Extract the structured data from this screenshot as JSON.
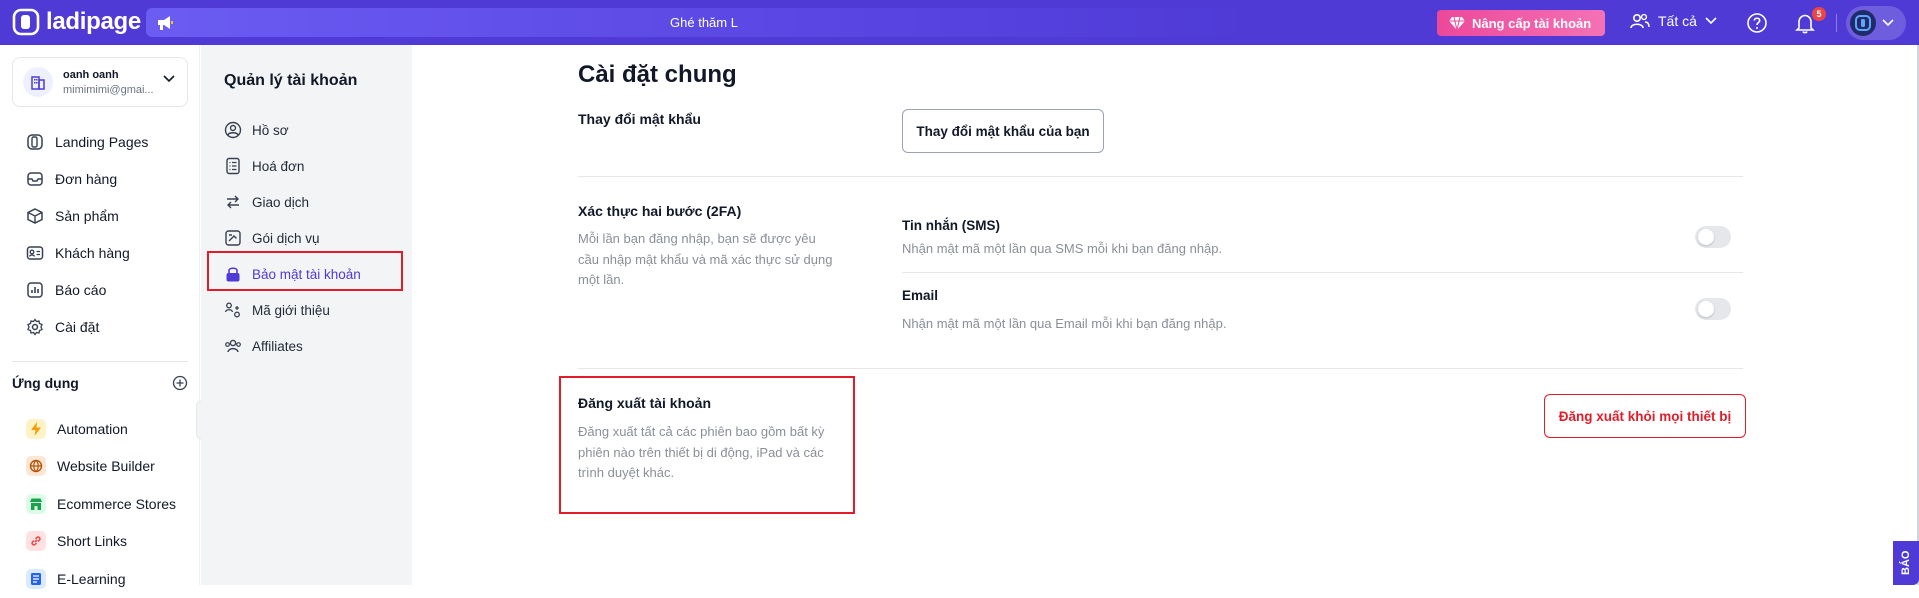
{
  "brand": {
    "name": "ladipage"
  },
  "topbar": {
    "announcement": "Ghé thăm L",
    "upgrade_label": "Nâng cấp tài khoản",
    "workspace_label": "Tất cả",
    "notification_count": "5"
  },
  "account": {
    "name": "oanh oanh",
    "email": "mimimimi@gmai..."
  },
  "nav": [
    {
      "label": "Landing Pages",
      "icon": "page-icon"
    },
    {
      "label": "Đơn hàng",
      "icon": "inbox-icon"
    },
    {
      "label": "Sản phẩm",
      "icon": "box-icon"
    },
    {
      "label": "Khách hàng",
      "icon": "contact-card-icon"
    },
    {
      "label": "Báo cáo",
      "icon": "chart-icon"
    },
    {
      "label": "Cài đặt",
      "icon": "gear-icon"
    }
  ],
  "apps": {
    "title": "Ứng dụng",
    "items": [
      {
        "label": "Automation",
        "icon": "bolt-icon",
        "color": "#f59e0b"
      },
      {
        "label": "Website Builder",
        "icon": "globe-icon",
        "color": "#b45309"
      },
      {
        "label": "Ecommerce Stores",
        "icon": "store-icon",
        "color": "#16a34a"
      },
      {
        "label": "Short Links",
        "icon": "link-icon",
        "color": "#ef4444"
      },
      {
        "label": "E-Learning",
        "icon": "book-icon",
        "color": "#2563eb"
      }
    ]
  },
  "account_menu": {
    "title": "Quản lý tài khoản",
    "items": [
      {
        "label": "Hồ sơ",
        "icon": "user-circle-icon"
      },
      {
        "label": "Hoá đơn",
        "icon": "invoice-icon"
      },
      {
        "label": "Giao dịch",
        "icon": "transfer-icon"
      },
      {
        "label": "Gói dịch vụ",
        "icon": "package-icon"
      },
      {
        "label": "Bảo mật tài khoản",
        "icon": "lock-icon"
      },
      {
        "label": "Mã giới thiệu",
        "icon": "referral-icon"
      },
      {
        "label": "Affiliates",
        "icon": "users-icon"
      }
    ]
  },
  "main": {
    "title": "Cài đặt chung",
    "password": {
      "title": "Thay đổi mật khẩu",
      "button": "Thay đổi mật khẩu của bạn"
    },
    "twofa": {
      "title": "Xác thực hai bước (2FA)",
      "desc": "Mỗi lần bạn đăng nhập, bạn sẽ được yêu cầu nhập mật khẩu và mã xác thực sử dụng một lần.",
      "sms_title": "Tin nhắn (SMS)",
      "sms_desc": "Nhận mật mã một lần qua SMS mỗi khi bạn đăng nhập.",
      "email_title": "Email",
      "email_desc": "Nhận mật mã một lần qua Email mỗi khi bạn đăng nhập."
    },
    "logout": {
      "title": "Đăng xuất tài khoản",
      "desc": "Đăng xuất tất cả các phiên bao gồm bất kỳ phiên nào trên thiết bị di động, iPad và các trình duyệt khác.",
      "button": "Đăng xuất khỏi mọi thiết bị"
    }
  },
  "report_tab": "BÁO",
  "colors": {
    "brand": "#4f3ad6",
    "danger": "#e11d2a",
    "upgrade": "#ec4899"
  }
}
